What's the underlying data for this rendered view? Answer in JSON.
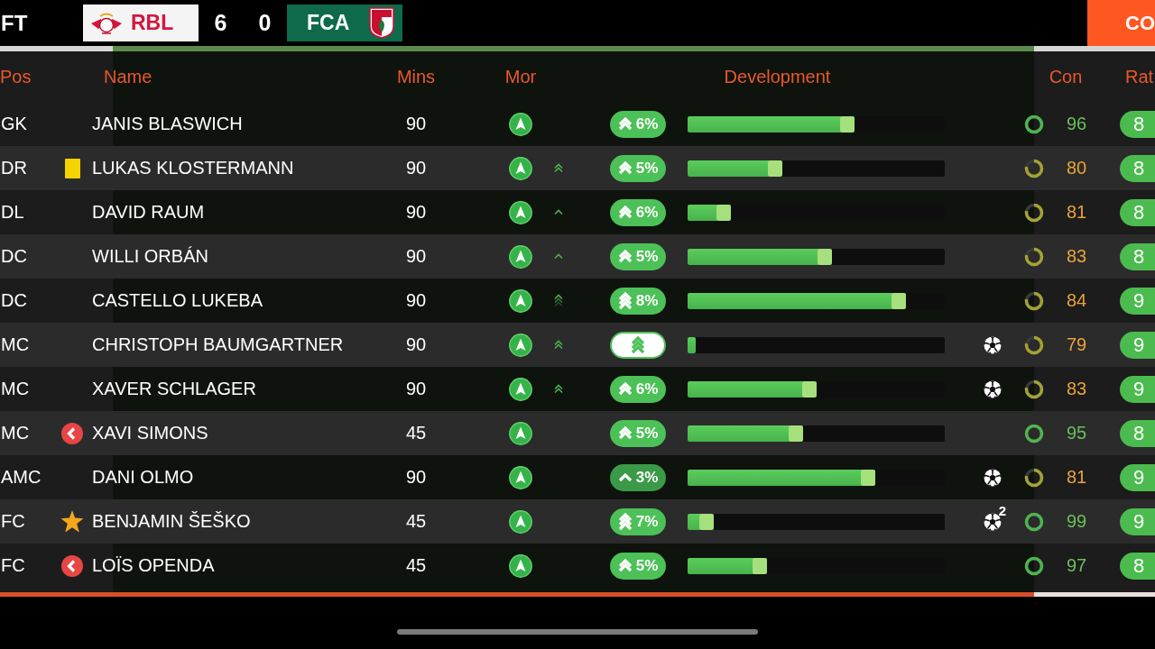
{
  "match": {
    "status": "FT",
    "home": {
      "abbr": "RBL",
      "score": "6"
    },
    "away": {
      "abbr": "FCA",
      "score": "0"
    },
    "action": "CO"
  },
  "table": {
    "columns": [
      "Pos",
      "Name",
      "Mins",
      "Mor",
      "Development",
      "Con",
      "Rat"
    ],
    "rows": [
      {
        "position": "GK",
        "name": "JANIS BLASWICH",
        "minutes": "90",
        "development": {
          "kind": "double",
          "text": "6%",
          "level": 0.65
        },
        "scored": false,
        "condition": {
          "text": "96",
          "kind": "fresh"
        },
        "rating": "8"
      },
      {
        "position": "DR",
        "event": {
          "kind": "booking"
        },
        "name": "LUKAS KLOSTERMANN",
        "minutes": "90",
        "trend": {
          "kind": "double"
        },
        "development": {
          "kind": "double",
          "text": "5%",
          "level": 0.37
        },
        "scored": false,
        "condition": {
          "text": "80",
          "kind": "tired"
        },
        "rating": "8"
      },
      {
        "position": "DL",
        "name": "DAVID RAUM",
        "minutes": "90",
        "trend": {
          "kind": "single"
        },
        "development": {
          "kind": "double",
          "text": "6%",
          "level": 0.17
        },
        "scored": false,
        "condition": {
          "text": "81",
          "kind": "tired"
        },
        "rating": "8"
      },
      {
        "position": "DC",
        "name": "WILLI ORBÁN",
        "minutes": "90",
        "trend": {
          "kind": "single"
        },
        "development": {
          "kind": "double",
          "text": "5%",
          "level": 0.56
        },
        "scored": false,
        "condition": {
          "text": "83",
          "kind": "tired"
        },
        "rating": "8"
      },
      {
        "position": "DC",
        "name": "CASTELLO LUKEBA",
        "minutes": "90",
        "trend": {
          "kind": "triple"
        },
        "development": {
          "kind": "triple",
          "text": "8%",
          "level": 0.85
        },
        "scored": false,
        "condition": {
          "text": "84",
          "kind": "tired"
        },
        "rating": "9"
      },
      {
        "position": "MC",
        "name": "CHRISTOPH BAUMGARTNER",
        "minutes": "90",
        "trend": {
          "kind": "double"
        },
        "development": {
          "kind": "highlight",
          "level": 0.03
        },
        "scored": true,
        "condition": {
          "text": "79",
          "kind": "tired"
        },
        "rating": "9"
      },
      {
        "position": "MC",
        "name": "XAVER SCHLAGER",
        "minutes": "90",
        "trend": {
          "kind": "double"
        },
        "development": {
          "kind": "double",
          "text": "6%",
          "level": 0.5
        },
        "scored": true,
        "condition": {
          "text": "83",
          "kind": "tired"
        },
        "rating": "9"
      },
      {
        "position": "MC",
        "event": {
          "kind": "substitution"
        },
        "name": "XAVI SIMONS",
        "minutes": "45",
        "development": {
          "kind": "double",
          "text": "5%",
          "level": 0.45
        },
        "scored": false,
        "condition": {
          "text": "95",
          "kind": "fresh"
        },
        "rating": "8"
      },
      {
        "position": "AMC",
        "name": "DANI OLMO",
        "minutes": "90",
        "development": {
          "kind": "single",
          "text": "3%",
          "level": 0.73
        },
        "scored": true,
        "condition": {
          "text": "81",
          "kind": "tired"
        },
        "rating": "9"
      },
      {
        "position": "FC",
        "event": {
          "kind": "star"
        },
        "name": "BENJAMIN ŠEŠKO",
        "minutes": "45",
        "development": {
          "kind": "triple",
          "text": "7%",
          "level": 0.1
        },
        "scored": true,
        "goal_count": "2",
        "condition": {
          "text": "99",
          "kind": "fresh"
        },
        "rating": "9"
      },
      {
        "position": "FC",
        "event": {
          "kind": "substitution"
        },
        "name": "LOÏS OPENDA",
        "minutes": "45",
        "development": {
          "kind": "double",
          "text": "5%",
          "level": 0.31
        },
        "scored": false,
        "condition": {
          "text": "97",
          "kind": "fresh"
        },
        "rating": "8"
      }
    ]
  }
}
